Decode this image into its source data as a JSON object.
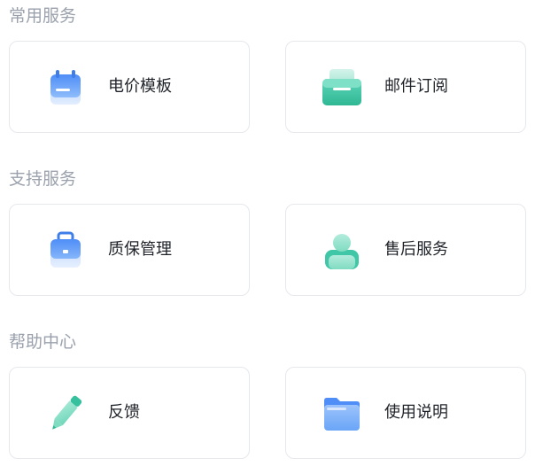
{
  "sections": [
    {
      "title": "常用服务",
      "items": [
        {
          "label": "电价模板",
          "icon": "calendar-icon"
        },
        {
          "label": "邮件订阅",
          "icon": "mail-icon"
        }
      ]
    },
    {
      "title": "支持服务",
      "items": [
        {
          "label": "质保管理",
          "icon": "briefcase-icon"
        },
        {
          "label": "售后服务",
          "icon": "user-icon"
        }
      ]
    },
    {
      "title": "帮助中心",
      "items": [
        {
          "label": "反馈",
          "icon": "pencil-icon"
        },
        {
          "label": "使用说明",
          "icon": "folder-icon"
        }
      ]
    }
  ],
  "colors": {
    "section_title": "#9aa1ac",
    "card_border": "#e6e8ec",
    "label": "#1f2329",
    "icon_blue": "#5b9cf6",
    "icon_teal": "#3fc7a8"
  }
}
